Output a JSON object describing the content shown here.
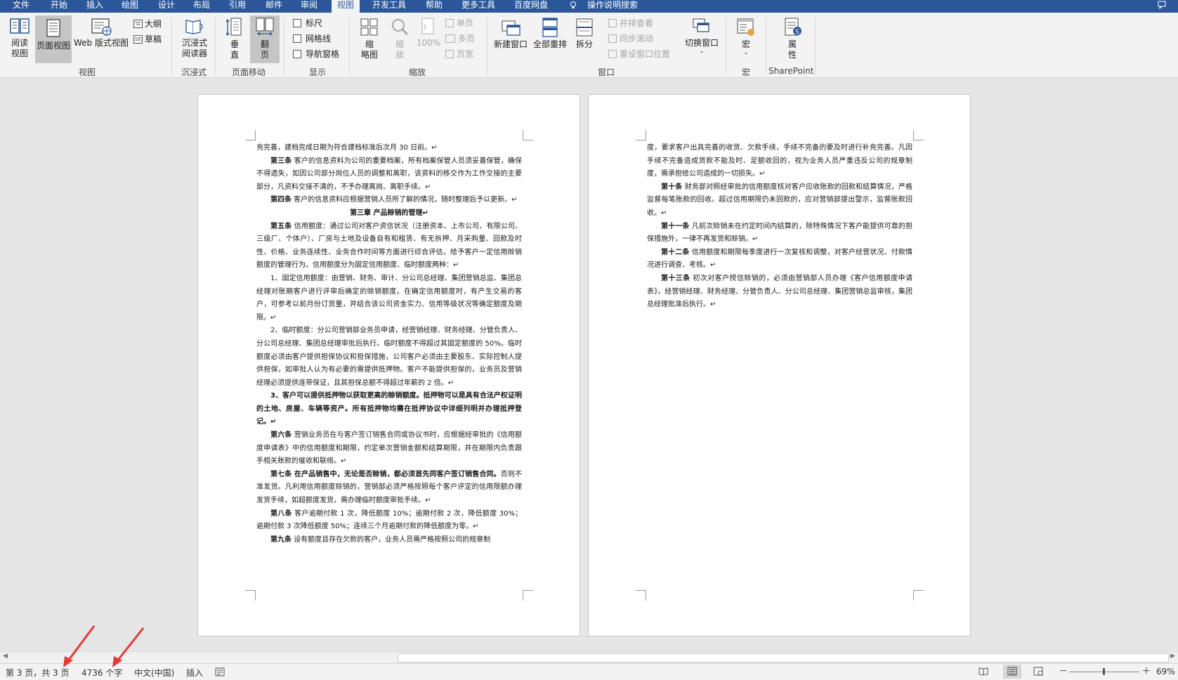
{
  "tabs": [
    "文件",
    "开始",
    "插入",
    "绘图",
    "设计",
    "布局",
    "引用",
    "邮件",
    "审阅",
    "视图",
    "开发工具",
    "帮助",
    "更多工具",
    "百度网盘",
    "操作说明搜索"
  ],
  "ribbon": {
    "views": {
      "read": "阅读\n视图",
      "print": "页面视图",
      "web": "Web 版式视图",
      "outline": "大纲",
      "draft": "草稿",
      "label": "视图"
    },
    "immersive": {
      "reader": "沉浸式\n阅读器",
      "label": "沉浸式"
    },
    "page_move": {
      "vertical": "垂\n直",
      "flip": "翻\n页",
      "label": "页面移动"
    },
    "show": {
      "ruler": "标尺",
      "gridlines": "网格线",
      "nav": "导航窗格",
      "label": "显示"
    },
    "zoom": {
      "zoom": "缩\n放",
      "pct": "100%",
      "one_page": "单页",
      "multi_page": "多页",
      "page_width": "页宽",
      "label": "缩放",
      "ratio": "缩\n略图"
    },
    "window": {
      "new": "新建窗口",
      "arrange": "全部重排",
      "split": "拆分",
      "side": "并排查看",
      "sync": "同步滚动",
      "reset": "重设窗口位置",
      "switch": "切换窗口",
      "label": "窗口"
    },
    "macro": {
      "macro": "宏",
      "label": "宏"
    },
    "sharepoint": {
      "prop": "属\n性",
      "label": "SharePoint"
    }
  },
  "page1": {
    "lines": [
      {
        "t": "充完善，建档完成日期为符合建档标准后次月 30 日前。↵",
        "cls": ""
      },
      {
        "t": "第三条 客户的信息资料为公司的重要档案，所有档案保管人员须妥善保管，确保不得遗失，如因公司部分岗位人员的调整和离职，该资料的移交作为工作交接的主要部分，凡资料交接不清的，不予办理离岗、离职手续。↵",
        "cls": "ind",
        "bold": "第三条"
      },
      {
        "t": "第四条 客户的信息资料应根据营销人员所了解的情况，随时整理后予以更新。↵",
        "cls": "ind",
        "bold": "第四条"
      },
      {
        "t": "第三章  产品赊销的管理↵",
        "cls": "ctr"
      },
      {
        "t": "第五条 信用额度：通过公司对客户资信状况（注册资本、上市公司、有限公司、三级厂、个体户）、厂房与土地及设备自有和租赁、有无拆押、月采购量、回款及时性、价格、业务连续性、业务合作时间等方面进行综合评估，给予客户一定信用赊销额度的管理行为。信用额度分为固定信用额度、临时额度两种：↵",
        "cls": "ind",
        "bold": "第五条"
      },
      {
        "t": "1、固定信用额度：由营销、财务、审计、分公司总经理、集团营销总监、集团总经理对账期客户进行评审后确定的赊销额度。在确定信用额度时，有产生交易的客户，可参考以前月份订货量，并结合该公司资金实力、信用等级状况等确定额度及期限。↵",
        "cls": "ind"
      },
      {
        "t": "2、临时额度：分公司营销部业务员申请，经营销经理、财务经理、分管负责人、分公司总经理、集团总经理审批后执行。临时额度不得超过其固定额度的 50%。临时额度必须由客户提供担保协议和担保措施，公司客户必须由主要股东、实际控制人提供担保，如审批人认为有必要的需提供抵押物。客户不能提供担保的，业务员及营销经理必须提供连带保证，且其担保总额不得超过年薪的 2 倍。↵",
        "cls": "ind"
      },
      {
        "t": "3、客户可以提供抵押物以获取更高的赊销额度。抵押物可以是具有合法产权证明的土地、房屋、车辆等资产。所有抵押物均需在抵押协议中详细列明并办理抵押登记。↵",
        "cls": "ind b"
      },
      {
        "t": "第六条 营销业务员在与客户签订销售合同或协议书时，应根据经审批的《信用额度申请表》中的信用额度和期限，约定单次营销金额和结算期限，并在期限内负责跟手相关账款的催收和联络。↵",
        "cls": "ind",
        "bold": "第六条"
      },
      {
        "t": "第七条 在产品销售中，无论是否赊销，都必须首先同客户签订销售合同。否则不准发货。凡利用信用额度赊销的，营销部必须严格按照每个客户评定的信用限额办理发货手续，如超额度发货，需办理临时额度审批手续。↵",
        "cls": "ind",
        "bold": "第七条 在产品销售中，无论是否赊销，都必须首先同客户签订销售合同。"
      },
      {
        "t": "第八条 客户逾期付款 1 次，降低额度 10%；逾期付款 2 次，降低额度 30%；逾期付款 3 次降低额度 50%；连续三个月逾期付款的降低额度为零。↵",
        "cls": "ind",
        "bold": "第八条"
      },
      {
        "t": "第九条 设有额度且存在欠款的客户，业务人员需严格按照公司的规章制",
        "cls": "ind",
        "bold": "第九条"
      }
    ]
  },
  "page2": {
    "lines": [
      {
        "t": "度，要求客户出具完善的收货、欠款手续，手续不完备的要及时进行补充完善。凡因手续不完备造成货款不能及时、足额收回的，视为业务人员严重违反公司的规章制度，需承担给公司造成的一切损失。↵",
        "cls": ""
      },
      {
        "t": "第十条 财务部对照经审批的信用额度核对客户应收账款的回款和结算情况，严格监督每笔账款的回收。超过信用期限仍未回款的，应对营销部提出警示，监督账款回收。↵",
        "cls": "ind",
        "bold": "第十条"
      },
      {
        "t": "第十一条 凡前次赊销未在约定时间内结算的，除特殊情况下客户能提供可靠的担保措施外，一律不再发货和赊销。↵",
        "cls": "ind",
        "bold": "第十一条"
      },
      {
        "t": "第十二条 信用额度和期限每季度进行一次复核和调整，对客户经营状况、付款情况进行调查、考核。↵",
        "cls": "ind",
        "bold": "第十二条"
      },
      {
        "t": "第十三条 初次对客户授信赊销的，必须由营销部人员办理《客户信用额度申请表》，经营销经理、财务经理、分管负责人、分公司总经理、集团营销总监审核，集团总经理批准后执行。↵",
        "cls": "ind",
        "bold": "第十三条"
      }
    ]
  },
  "status": {
    "page": "第 3 页，共 3 页",
    "words": "4736 个字",
    "lang": "中文(中国)",
    "mode": "插入",
    "zoom": "69%"
  }
}
